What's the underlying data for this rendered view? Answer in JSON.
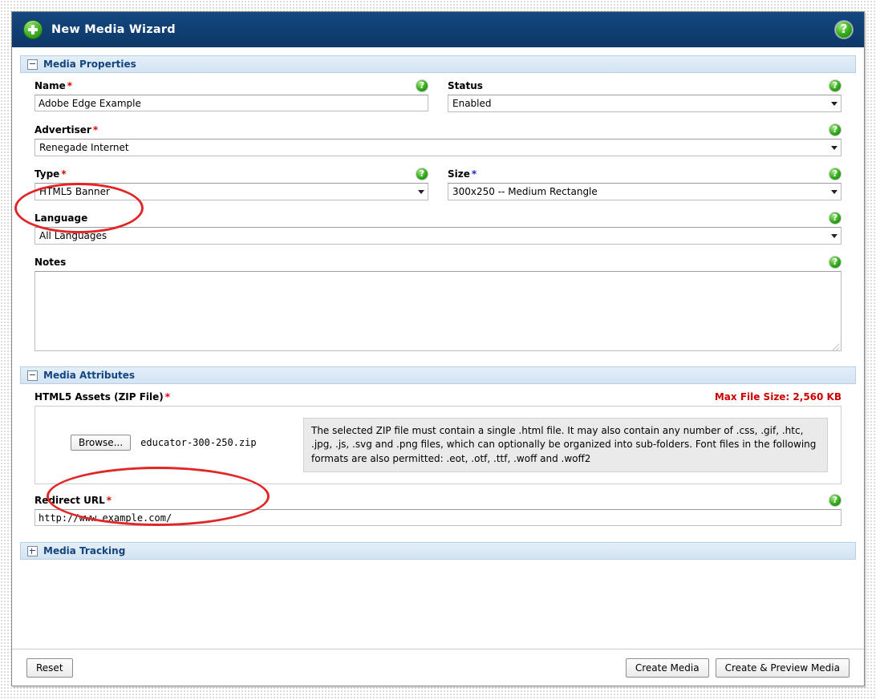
{
  "window": {
    "title": "New Media Wizard",
    "title_icon": "plus-circle-icon",
    "help_icon": "help-question-icon"
  },
  "sections": {
    "media_properties": {
      "title": "Media Properties",
      "collapsed": false
    },
    "media_attributes": {
      "title": "Media Attributes",
      "collapsed": false
    },
    "media_tracking": {
      "title": "Media Tracking",
      "collapsed": true
    }
  },
  "fields": {
    "name": {
      "label": "Name",
      "required_marker": "*",
      "value": "Adobe Edge Example"
    },
    "status": {
      "label": "Status",
      "required_marker": "",
      "value": "Enabled"
    },
    "advertiser": {
      "label": "Advertiser",
      "required_marker": "*",
      "value": "Renegade Internet"
    },
    "type": {
      "label": "Type",
      "required_marker": "*",
      "value": "HTML5 Banner"
    },
    "size": {
      "label": "Size",
      "required_marker": "*",
      "value": "300x250 -- Medium Rectangle"
    },
    "language": {
      "label": "Language",
      "required_marker": "",
      "value": "All Languages"
    },
    "notes": {
      "label": "Notes",
      "required_marker": "",
      "value": ""
    },
    "html5_assets": {
      "label": "HTML5 Assets (ZIP File)",
      "required_marker": "*",
      "max_file_size": "Max File Size: 2,560 KB",
      "browse_label": "Browse...",
      "file_name": "educator-300-250.zip",
      "info_text": "The selected ZIP file must contain a single .html file. It may also contain any number of .css, .gif, .htc, .jpg, .js, .svg and .png files, which can optionally be organized into sub-folders. Font files in the following formats are also permitted: .eot, .otf, .ttf, .woff and .woff2"
    },
    "redirect_url": {
      "label": "Redirect URL",
      "required_marker": "*",
      "value": "http://www.example.com/"
    }
  },
  "footer": {
    "reset_label": "Reset",
    "create_media_label": "Create Media",
    "create_preview_label": "Create & Preview Media"
  },
  "colors": {
    "titlebar": "#104075",
    "section_bar": "#dce9f6",
    "section_title": "#14457e",
    "required_red": "#e00000",
    "annotation_red": "#e02626",
    "max_size_red": "#cc0000",
    "help_green": "#2faa18"
  }
}
